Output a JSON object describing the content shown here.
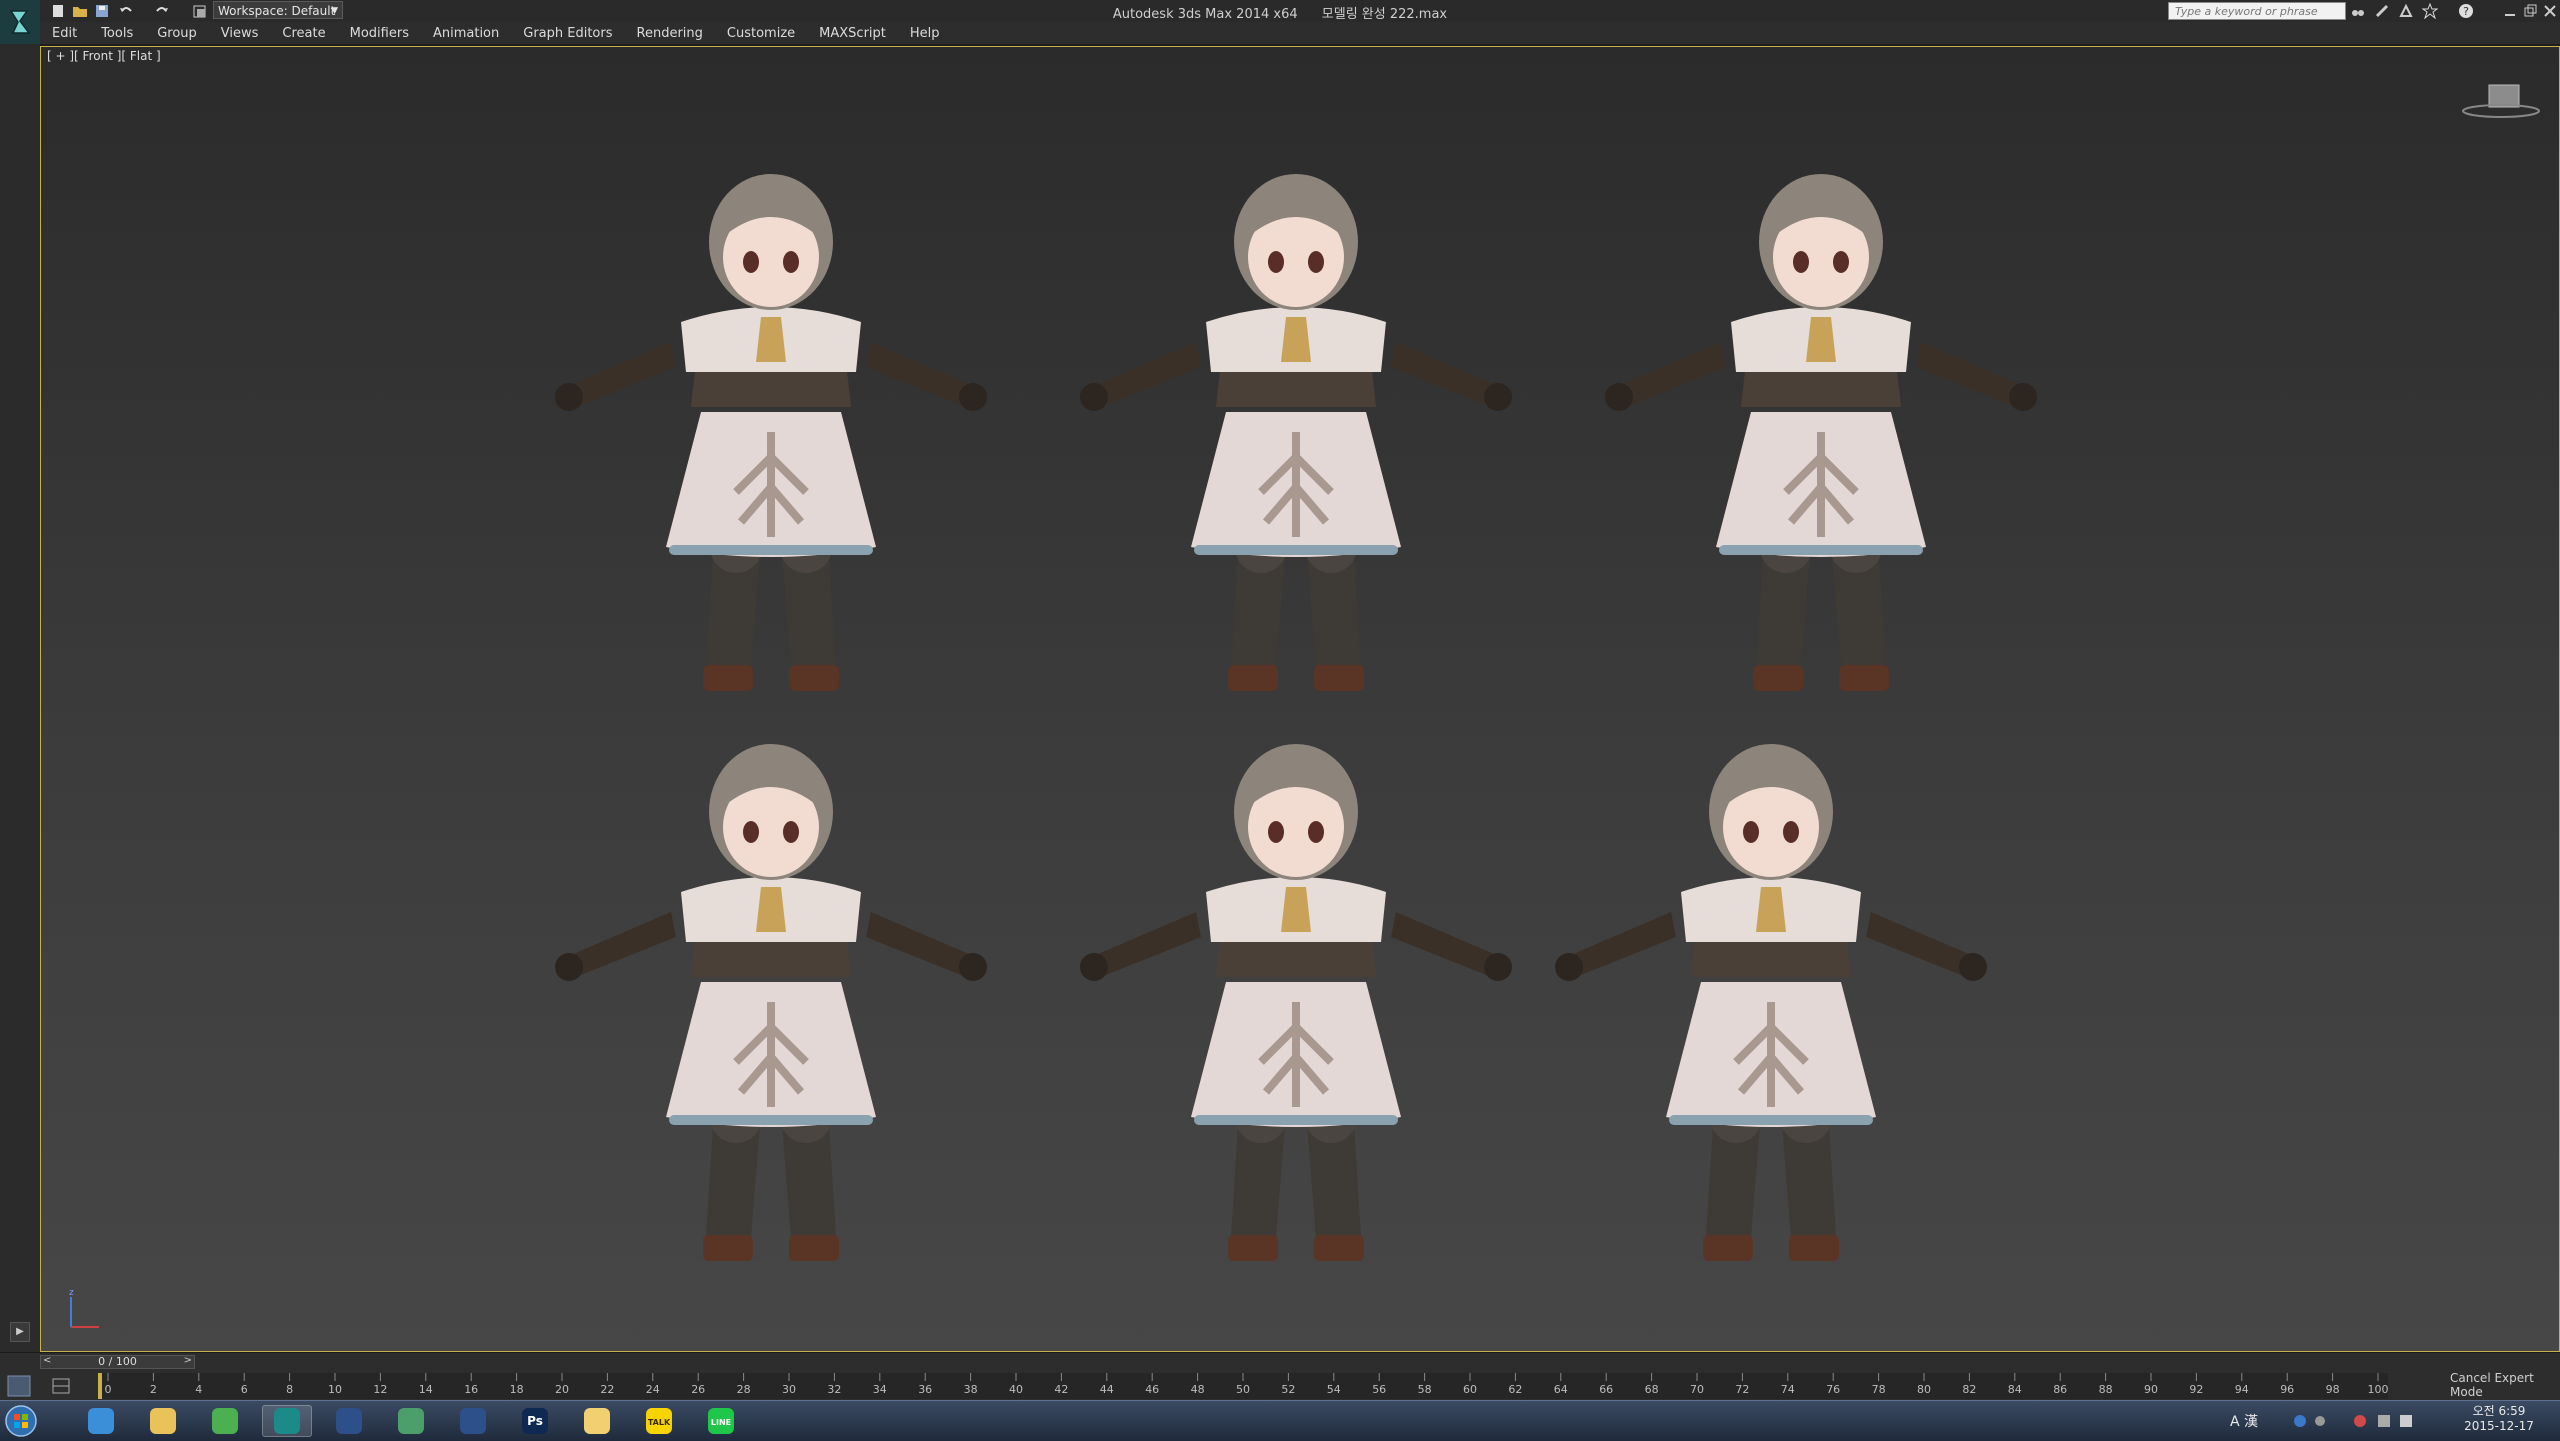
{
  "titlebar": {
    "workspace_label": "Workspace: Default",
    "app_title": "Autodesk 3ds Max  2014 x64",
    "file_name": "모델링 완성 222.max",
    "search_placeholder": "Type a keyword or phrase"
  },
  "menu": [
    "Edit",
    "Tools",
    "Group",
    "Views",
    "Create",
    "Modifiers",
    "Animation",
    "Graph Editors",
    "Rendering",
    "Customize",
    "MAXScript",
    "Help"
  ],
  "viewport": {
    "label": "[ + ][ Front ][ Flat ]",
    "figure_count": 6
  },
  "timeline": {
    "frame_counter": "0 / 100",
    "ticks": [
      "0",
      "2",
      "4",
      "6",
      "8",
      "10",
      "12",
      "14",
      "16",
      "18",
      "20",
      "22",
      "24",
      "26",
      "28",
      "30",
      "32",
      "34",
      "36",
      "38",
      "40",
      "42",
      "44",
      "46",
      "48",
      "50",
      "52",
      "54",
      "56",
      "58",
      "60",
      "62",
      "64",
      "66",
      "68",
      "70",
      "72",
      "74",
      "76",
      "78",
      "80",
      "82",
      "84",
      "86",
      "88",
      "90",
      "92",
      "94",
      "96",
      "98",
      "100"
    ],
    "cancel_expert_mode": "Cancel Expert Mode"
  },
  "taskbar": {
    "apps": [
      {
        "name": "internet-explorer",
        "label": "",
        "color": "#3a8fd8"
      },
      {
        "name": "file-explorer",
        "label": "",
        "color": "#e9c35a"
      },
      {
        "name": "chrome",
        "label": "",
        "color": "#4caf50"
      },
      {
        "name": "3ds-max",
        "label": "",
        "color": "#1d8a8a"
      },
      {
        "name": "media-player",
        "label": "",
        "color": "#2d4f8a"
      },
      {
        "name": "app-diamond",
        "label": "",
        "color": "#4c9f6a"
      },
      {
        "name": "media-player-2",
        "label": "",
        "color": "#2d4f8a"
      },
      {
        "name": "photoshop",
        "label": "Ps",
        "color": "#0e2a52"
      },
      {
        "name": "folder",
        "label": "",
        "color": "#f0d070"
      },
      {
        "name": "kakaotalk",
        "label": "TALK",
        "color": "#f7d400"
      },
      {
        "name": "line",
        "label": "LINE",
        "color": "#1ec74a"
      }
    ],
    "clock_time": "오전 6:59",
    "clock_date": "2015-12-17"
  },
  "colors": {
    "viewport_border": "#c8b14a",
    "taskbar": "#2a3850"
  }
}
